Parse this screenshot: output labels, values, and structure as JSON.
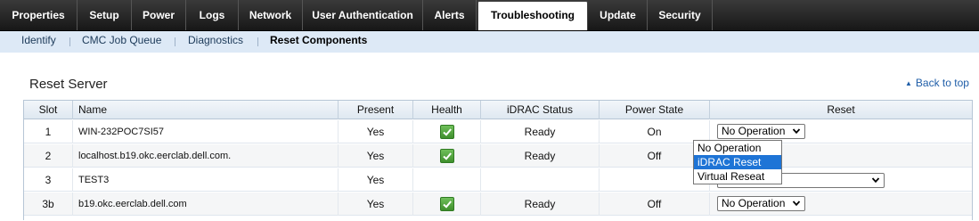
{
  "top_nav": {
    "tabs": [
      {
        "label": "Properties"
      },
      {
        "label": "Setup"
      },
      {
        "label": "Power"
      },
      {
        "label": "Logs"
      },
      {
        "label": "Network"
      },
      {
        "label": "User Authentication"
      },
      {
        "label": "Alerts"
      },
      {
        "label": "Troubleshooting",
        "active": true
      },
      {
        "label": "Update"
      },
      {
        "label": "Security"
      }
    ]
  },
  "sub_nav": {
    "items": [
      {
        "label": "Identify"
      },
      {
        "label": "CMC Job Queue"
      },
      {
        "label": "Diagnostics"
      },
      {
        "label": "Reset Components",
        "active": true
      }
    ]
  },
  "section": {
    "title": "Reset Server",
    "back_to_top": "Back to top"
  },
  "table": {
    "headers": [
      "Slot",
      "Name",
      "Present",
      "Health",
      "iDRAC Status",
      "Power State",
      "Reset"
    ],
    "rows": [
      {
        "slot": "1",
        "name": "WIN-232POC7SI57",
        "present": "Yes",
        "health": "ok",
        "idrac_status": "Ready",
        "power_state": "On",
        "reset": "No Operation"
      },
      {
        "slot": "2",
        "name": "localhost.b19.okc.eerclab.dell.com.",
        "present": "Yes",
        "health": "ok",
        "idrac_status": "Ready",
        "power_state": "Off",
        "reset": ""
      },
      {
        "slot": "3",
        "name": "TEST3",
        "present": "Yes",
        "health": "",
        "idrac_status": "",
        "power_state": "",
        "reset": ""
      },
      {
        "slot": "3b",
        "name": "b19.okc.eerclab.dell.com",
        "present": "Yes",
        "health": "ok",
        "idrac_status": "Ready",
        "power_state": "Off",
        "reset": "No Operation"
      }
    ]
  },
  "reset_dropdown": {
    "options": [
      "No Operation",
      "iDRAC Reset",
      "Virtual Reseat"
    ],
    "highlighted": "iDRAC Reset"
  },
  "colors": {
    "top_nav_bg": "#1e1e1e",
    "sub_nav_bg": "#dde9f6",
    "link": "#1f5ea8",
    "health_ok": "#4a9a36",
    "option_highlight": "#1e74d6"
  }
}
